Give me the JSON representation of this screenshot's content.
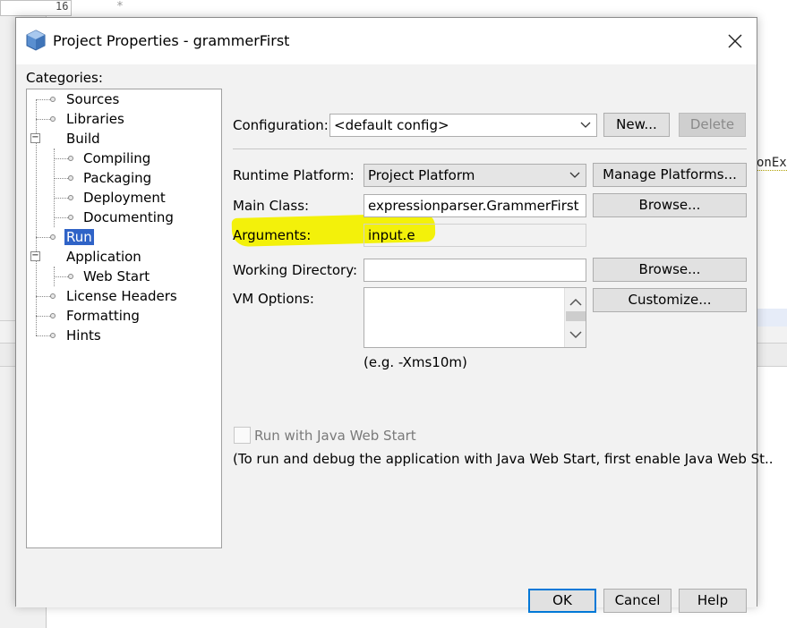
{
  "ide": {
    "line_number": "16",
    "star": "*",
    "right_fragment": "onEx"
  },
  "dialog": {
    "title": "Project Properties - grammerFirst"
  },
  "categories": {
    "label": "Categories:",
    "items": [
      {
        "label": "Sources"
      },
      {
        "label": "Libraries"
      },
      {
        "label": "Build"
      },
      {
        "label": "Compiling"
      },
      {
        "label": "Packaging"
      },
      {
        "label": "Deployment"
      },
      {
        "label": "Documenting"
      },
      {
        "label": "Run"
      },
      {
        "label": "Application"
      },
      {
        "label": "Web Start"
      },
      {
        "label": "License Headers"
      },
      {
        "label": "Formatting"
      },
      {
        "label": "Hints"
      }
    ],
    "selected": "Run"
  },
  "config": {
    "label": "Configuration:",
    "value": "<default config>",
    "new_label": "New...",
    "delete_label": "Delete"
  },
  "runtime": {
    "label": "Runtime Platform:",
    "value": "Project Platform",
    "manage_label": "Manage Platforms..."
  },
  "main_class": {
    "label": "Main Class:",
    "value": "expressionparser.GrammerFirst",
    "browse_label": "Browse..."
  },
  "arguments": {
    "label": "Arguments:",
    "value": "input.e"
  },
  "working_dir": {
    "label": "Working Directory:",
    "value": "",
    "browse_label": "Browse..."
  },
  "vm_options": {
    "label": "VM Options:",
    "value": "",
    "customize_label": "Customize...",
    "hint": "(e.g. -Xms10m)"
  },
  "web_start": {
    "checkbox_label": "Run with Java Web Start",
    "note": "(To run and debug the application with Java Web Start, first enable Java Web St.."
  },
  "footer": {
    "ok_label": "OK",
    "cancel_label": "Cancel",
    "help_label": "Help"
  },
  "colors": {
    "selection": "#2f63c7",
    "highlight": "#f3f10a",
    "default_button_border": "#0078d7"
  }
}
